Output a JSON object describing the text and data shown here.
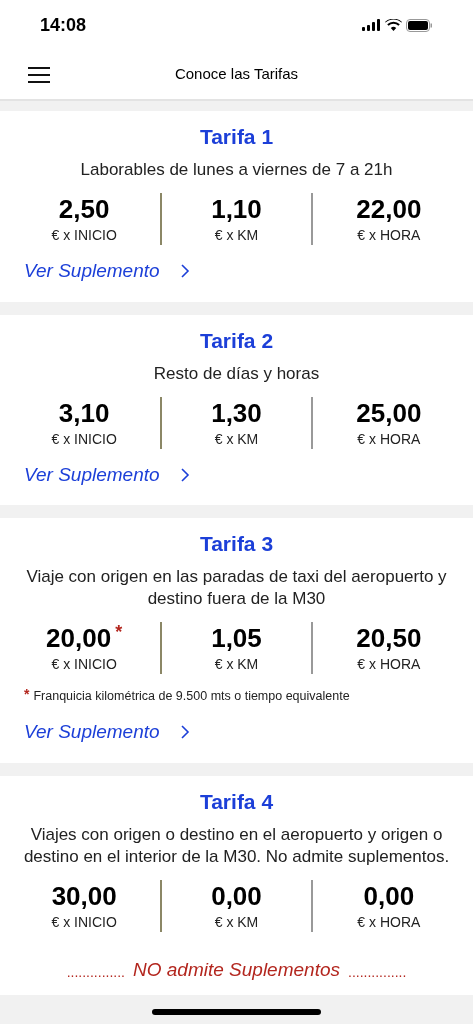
{
  "status_bar": {
    "time": "14:08"
  },
  "header": {
    "title": "Conoce las Tarifas"
  },
  "tariffs": [
    {
      "title": "Tarifa 1",
      "description": "Laborables de lunes a viernes de 7 a 21h",
      "prices": [
        {
          "value": "2,50",
          "unit": "€ x INICIO"
        },
        {
          "value": "1,10",
          "unit": "€ x KM"
        },
        {
          "value": "22,00",
          "unit": "€ x HORA"
        }
      ],
      "footer": {
        "kind": "link",
        "text": "Ver Suplemento"
      }
    },
    {
      "title": "Tarifa 2",
      "description": "Resto de días y horas",
      "prices": [
        {
          "value": "3,10",
          "unit": "€ x INICIO"
        },
        {
          "value": "1,30",
          "unit": "€ x KM"
        },
        {
          "value": "25,00",
          "unit": "€ x HORA"
        }
      ],
      "footer": {
        "kind": "link",
        "text": "Ver Suplemento"
      }
    },
    {
      "title": "Tarifa 3",
      "description": "Viaje con origen en las paradas de taxi del aeropuerto y destino fuera de la M30",
      "prices": [
        {
          "value": "20,00",
          "mark": "*",
          "unit": "€ x INICIO"
        },
        {
          "value": "1,05",
          "unit": "€ x KM"
        },
        {
          "value": "20,50",
          "unit": "€ x HORA"
        }
      ],
      "note": {
        "mark": "*",
        "text": "Franquicia kilométrica de 9.500 mts o tiempo equivalente"
      },
      "footer": {
        "kind": "link",
        "text": "Ver Suplemento"
      }
    },
    {
      "title": "Tarifa 4",
      "description": "Viajes con origen o destino en el aeropuerto y origen o destino en el interior de la M30. No admite suplementos.",
      "prices": [
        {
          "value": "30,00",
          "unit": "€ x INICIO"
        },
        {
          "value": "0,00",
          "unit": "€ x KM"
        },
        {
          "value": "0,00",
          "unit": "€ x HORA"
        }
      ],
      "footer": {
        "kind": "notice",
        "text": "NO admite Suplementos",
        "dots_left": "...............",
        "dots_right": "..............."
      }
    }
  ]
}
